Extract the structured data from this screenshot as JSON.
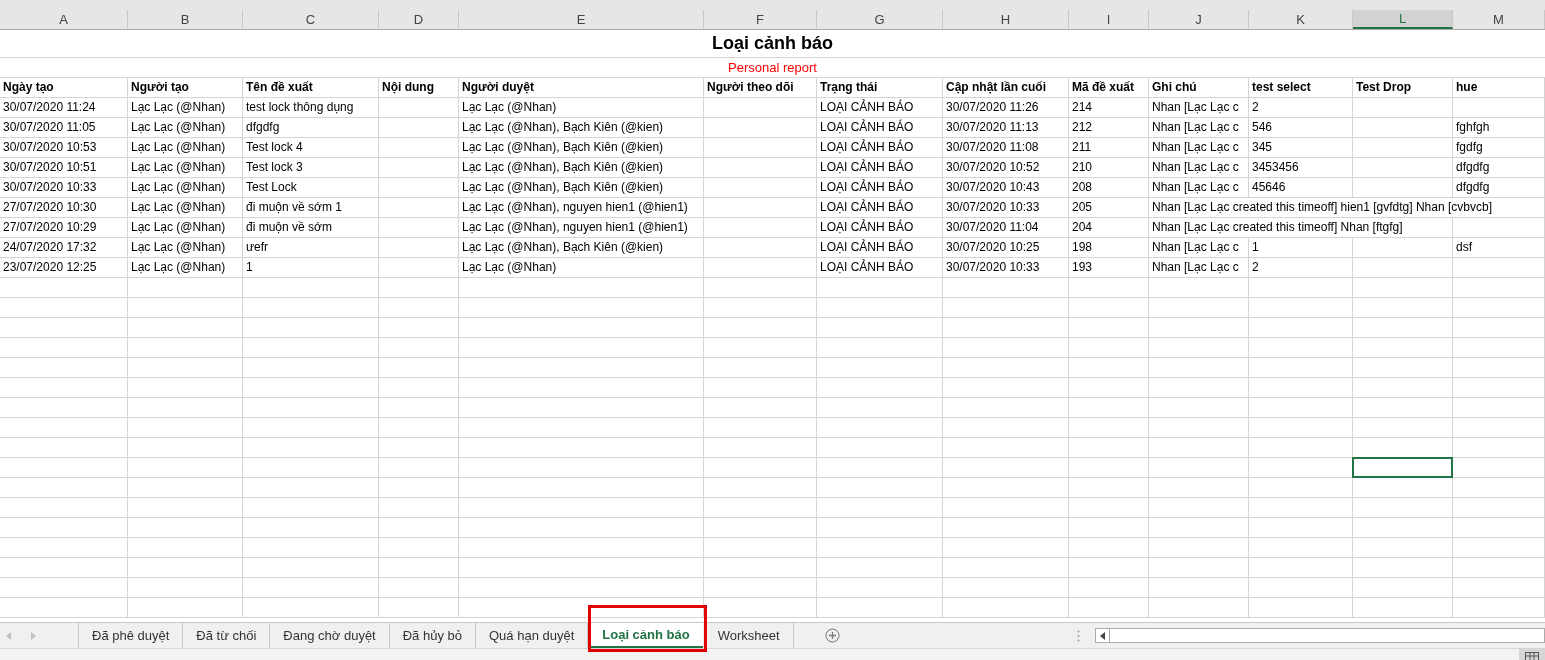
{
  "columns": [
    {
      "letter": "A",
      "selected": false
    },
    {
      "letter": "B",
      "selected": false
    },
    {
      "letter": "C",
      "selected": false
    },
    {
      "letter": "D",
      "selected": false
    },
    {
      "letter": "E",
      "selected": false
    },
    {
      "letter": "F",
      "selected": false
    },
    {
      "letter": "G",
      "selected": false
    },
    {
      "letter": "H",
      "selected": false
    },
    {
      "letter": "I",
      "selected": false
    },
    {
      "letter": "J",
      "selected": false
    },
    {
      "letter": "K",
      "selected": false
    },
    {
      "letter": "L",
      "selected": true
    },
    {
      "letter": "M",
      "selected": false
    }
  ],
  "title": "Loại cảnh báo",
  "subtitle": "Personal report",
  "header": {
    "A": "Ngày tạo",
    "B": "Người tạo",
    "C": "Tên đề xuất",
    "D": "Nội dung",
    "E": "Người duyệt",
    "F": "Người theo dõi",
    "G": "Trạng thái",
    "H": "Cập nhật lần cuối",
    "I": "Mã đề xuất",
    "J": "Ghi chú",
    "K": "test select",
    "L": "Test Drop",
    "M": "hue"
  },
  "rows": [
    {
      "A": "30/07/2020 11:24",
      "B": "Lạc Lạc (@Nhan)",
      "C": "test lock thông dụng",
      "E": "Lạc Lạc (@Nhan)",
      "G": "LOẠI CẢNH BÁO",
      "H": "30/07/2020 11:26",
      "I": "214",
      "J": "Nhan [Lạc Lạc c",
      "K": "2"
    },
    {
      "A": "30/07/2020 11:05",
      "B": "Lạc Lạc (@Nhan)",
      "C": "dfgdfg",
      "E": "Lạc Lạc (@Nhan), Bạch Kiên (@kien)",
      "G": "LOẠI CẢNH BÁO",
      "H": "30/07/2020 11:13",
      "I": "212",
      "J": "Nhan [Lạc Lạc c",
      "K": "546",
      "M": "fghfgh"
    },
    {
      "A": "30/07/2020 10:53",
      "B": "Lạc Lạc (@Nhan)",
      "C": "Test lock 4",
      "E": "Lạc Lạc (@Nhan), Bạch Kiên (@kien)",
      "G": "LOẠI CẢNH BÁO",
      "H": "30/07/2020 11:08",
      "I": "211",
      "J": "Nhan [Lạc Lạc c",
      "K": "345",
      "M": "fgdfg"
    },
    {
      "A": "30/07/2020 10:51",
      "B": "Lạc Lạc (@Nhan)",
      "C": "Test lock 3",
      "E": "Lạc Lạc (@Nhan), Bạch Kiên (@kien)",
      "G": "LOẠI CẢNH BÁO",
      "H": "30/07/2020 10:52",
      "I": "210",
      "J": "Nhan [Lạc Lạc c",
      "K": "3453456",
      "M": "dfgdfg"
    },
    {
      "A": "30/07/2020 10:33",
      "B": "Lạc Lạc (@Nhan)",
      "C": "Test Lock",
      "E": "Lạc Lạc (@Nhan), Bạch Kiên (@kien)",
      "G": "LOẠI CẢNH BÁO",
      "H": "30/07/2020 10:43",
      "I": "208",
      "J": "Nhan [Lạc Lạc c",
      "K": "45646",
      "M": "dfgdfg"
    },
    {
      "A": "27/07/2020 10:30",
      "B": "Lạc Lạc (@Nhan)",
      "C": "đi muộn về sớm 1",
      "E": "Lạc Lạc (@Nhan), nguyen hien1 (@hien1)",
      "G": "LOẠI CẢNH BÁO",
      "H": "30/07/2020 10:33",
      "I": "205",
      "J": "Nhan [Lạc Lạc created this timeoff] hien1 [gvfdtg] Nhan [cvbvcb]"
    },
    {
      "A": "27/07/2020 10:29",
      "B": "Lạc Lạc (@Nhan)",
      "C": "đi muộn về sớm",
      "E": "Lạc Lạc (@Nhan), nguyen hien1 (@hien1)",
      "G": "LOẠI CẢNH BÁO",
      "H": "30/07/2020 11:04",
      "I": "204",
      "J": "Nhan [Lạc Lạc created this timeoff] Nhan [ftgfg]"
    },
    {
      "A": "24/07/2020 17:32",
      "B": "Lạc Lạc (@Nhan)",
      "C": "ưefr",
      "E": "Lạc Lạc (@Nhan), Bạch Kiên (@kien)",
      "G": "LOẠI CẢNH BÁO",
      "H": "30/07/2020 10:25",
      "I": "198",
      "J": "Nhan [Lạc Lạc c",
      "K": "1",
      "M": "dsf"
    },
    {
      "A": "23/07/2020 12:25",
      "B": "Lạc Lạc (@Nhan)",
      "C": "1",
      "E": "Lạc Lạc (@Nhan)",
      "G": "LOẠI CẢNH BÁO",
      "H": "30/07/2020 10:33",
      "I": "193",
      "J": "Nhan [Lạc Lạc c",
      "K": "2"
    }
  ],
  "blank_rows": [
    {
      "has_selection": false
    },
    {
      "has_selection": false
    },
    {
      "has_selection": false
    },
    {
      "has_selection": false
    },
    {
      "has_selection": false
    },
    {
      "has_selection": false
    },
    {
      "has_selection": false
    },
    {
      "has_selection": false
    },
    {
      "has_selection": false
    },
    {
      "has_selection": true
    },
    {
      "has_selection": false
    },
    {
      "has_selection": false
    },
    {
      "has_selection": false
    },
    {
      "has_selection": false
    },
    {
      "has_selection": false
    },
    {
      "has_selection": false
    },
    {
      "has_selection": false
    }
  ],
  "sheet_tabs": [
    {
      "label": "Đã phê duyệt",
      "selected": false
    },
    {
      "label": "Đã từ chối",
      "selected": false
    },
    {
      "label": "Đang chờ duyệt",
      "selected": false
    },
    {
      "label": "Đã hủy bỏ",
      "selected": false
    },
    {
      "label": "Quá hạn duyệt",
      "selected": false
    },
    {
      "label": "Loại cảnh báo",
      "selected": true
    },
    {
      "label": "Worksheet",
      "selected": false
    }
  ]
}
